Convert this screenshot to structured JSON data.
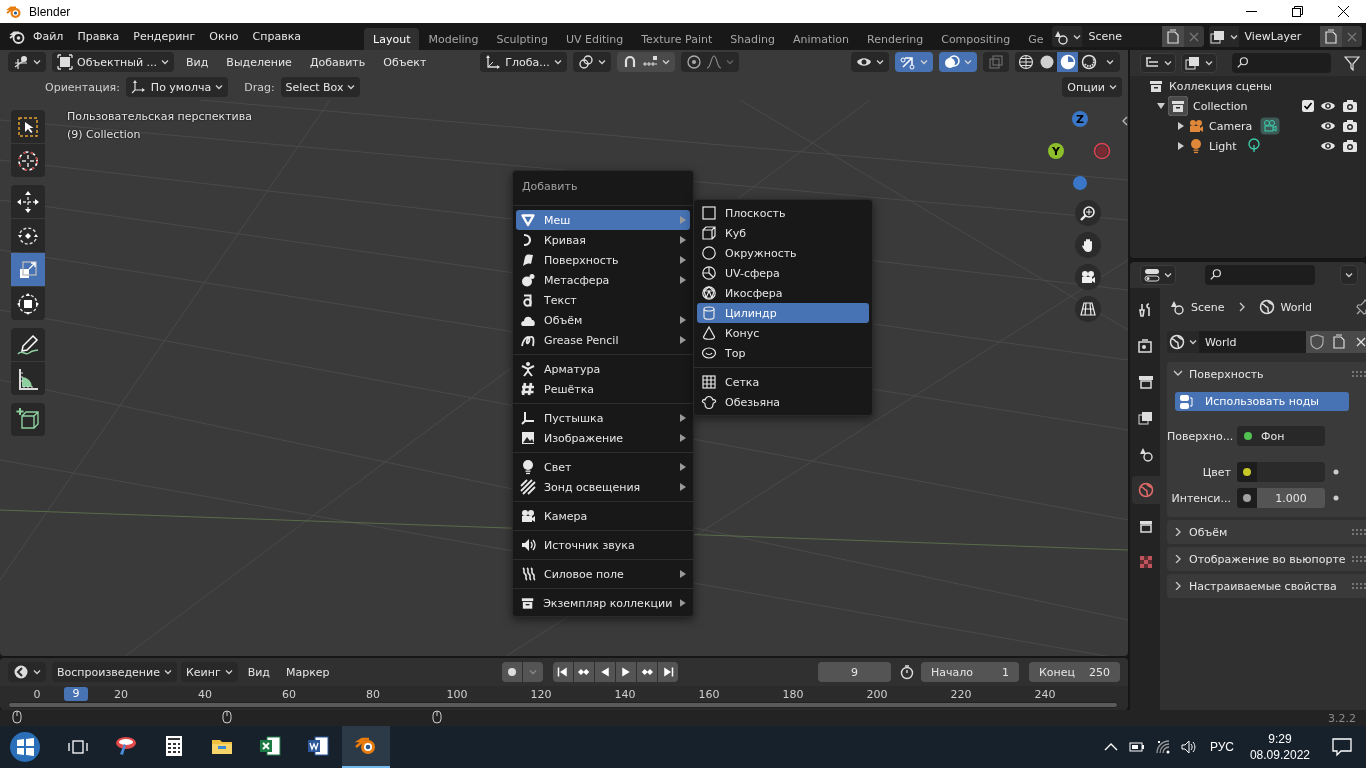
{
  "window": {
    "title": "Blender"
  },
  "menubar": [
    "Файл",
    "Правка",
    "Рендеринг",
    "Окно",
    "Справка"
  ],
  "workspaces": [
    {
      "label": "Layout",
      "selected": true
    },
    {
      "label": "Modeling",
      "selected": false
    },
    {
      "label": "Sculpting",
      "selected": false
    },
    {
      "label": "UV Editing",
      "selected": false
    },
    {
      "label": "Texture Paint",
      "selected": false
    },
    {
      "label": "Shading",
      "selected": false
    },
    {
      "label": "Animation",
      "selected": false
    },
    {
      "label": "Rendering",
      "selected": false
    },
    {
      "label": "Compositing",
      "selected": false
    },
    {
      "label": "Ge",
      "selected": false
    }
  ],
  "scene": "Scene",
  "view_layer": "ViewLayer",
  "viewport_header": {
    "mode": "Объектный ...",
    "menus": [
      "Вид",
      "Выделение",
      "Добавить",
      "Объект"
    ],
    "orientation": "Глоба...",
    "gizmos_on": true,
    "overlays_on": true,
    "shading": [
      {
        "selected": false
      },
      {
        "selected": false
      },
      {
        "selected": true
      },
      {
        "selected": false
      }
    ]
  },
  "tool_settings": {
    "orientation_label": "Ориентация:",
    "orientation": "По умолча",
    "drag_label": "Drag:",
    "drag": "Select Box",
    "options": "Опции"
  },
  "viewport": {
    "view_name": "Пользовательская перспектива",
    "collection": "(9) Collection",
    "gizmo_z": "Z",
    "gizmo_y": "Y"
  },
  "toolbar": [
    [
      {
        "selected": false
      },
      {
        "selected": false
      }
    ],
    [
      {
        "selected": false
      },
      {
        "selected": false
      },
      {
        "selected": true
      },
      {
        "selected": false
      }
    ],
    [
      {
        "selected": false
      },
      {
        "selected": false
      }
    ],
    [
      {
        "selected": false
      }
    ]
  ],
  "add_menu": {
    "title": "Добавить",
    "groups": [
      [
        {
          "label": "Меш",
          "submenu": true,
          "selected": true
        },
        {
          "label": "Кривая",
          "submenu": true,
          "selected": false
        },
        {
          "label": "Поверхность",
          "submenu": true,
          "selected": false
        },
        {
          "label": "Метасфера",
          "submenu": true,
          "selected": false
        },
        {
          "label": "Текст",
          "submenu": false,
          "selected": false
        },
        {
          "label": "Объём",
          "submenu": true,
          "selected": false
        },
        {
          "label": "Grease Pencil",
          "submenu": true,
          "selected": false
        }
      ],
      [
        {
          "label": "Арматура",
          "submenu": false,
          "selected": false
        },
        {
          "label": "Решётка",
          "submenu": false,
          "selected": false
        }
      ],
      [
        {
          "label": "Пустышка",
          "submenu": true,
          "selected": false
        },
        {
          "label": "Изображение",
          "submenu": true,
          "selected": false
        }
      ],
      [
        {
          "label": "Свет",
          "submenu": true,
          "selected": false
        },
        {
          "label": "Зонд освещения",
          "submenu": true,
          "selected": false
        }
      ],
      [
        {
          "label": "Камера",
          "submenu": false,
          "selected": false
        }
      ],
      [
        {
          "label": "Источник звука",
          "submenu": false,
          "selected": false
        }
      ],
      [
        {
          "label": "Силовое поле",
          "submenu": true,
          "selected": false
        }
      ],
      [
        {
          "label": "Экземпляр коллекции",
          "submenu": true,
          "selected": false
        }
      ]
    ]
  },
  "mesh_submenu": {
    "groups": [
      [
        {
          "label": "Плоскость",
          "selected": false
        },
        {
          "label": "Куб",
          "selected": false
        },
        {
          "label": "Окружность",
          "selected": false
        },
        {
          "label": "UV-сфера",
          "selected": false
        },
        {
          "label": "Икосфера",
          "selected": false
        },
        {
          "label": "Цилиндр",
          "selected": true
        },
        {
          "label": "Конус",
          "selected": false
        },
        {
          "label": "Тор",
          "selected": false
        }
      ],
      [
        {
          "label": "Сетка",
          "selected": false
        },
        {
          "label": "Обезьяна",
          "selected": false
        }
      ]
    ]
  },
  "outliner": {
    "tree": [
      {
        "label": "Коллекция сцены",
        "children": [
          {
            "label": "Collection",
            "expanded": true,
            "checked": true,
            "children": [
              {
                "label": "Camera",
                "expanded": false
              },
              {
                "label": "Light",
                "expanded": false
              }
            ]
          }
        ]
      }
    ]
  },
  "properties": {
    "tabs": [
      {
        "selected": false
      },
      {
        "selected": false
      },
      {
        "selected": false
      },
      {
        "selected": false
      },
      {
        "selected": false
      },
      {
        "selected": true
      },
      {
        "selected": false
      },
      {
        "selected": false
      }
    ],
    "breadcrumb": [
      "Scene",
      "World"
    ],
    "world": "World",
    "panels": [
      {
        "title": "Поверхность",
        "expanded": true,
        "button": "Использовать ноды",
        "fields": [
          {
            "kind": "shader",
            "label": "Поверхно...",
            "value": "Фон",
            "color": "#52c152",
            "animatable": false
          },
          {
            "kind": "color",
            "label": "Цвет",
            "color": "#c7c729",
            "animatable": true
          },
          {
            "kind": "number",
            "label": "Интенси...",
            "value": "1.000",
            "color": "#a1a1a1",
            "animatable": true
          }
        ]
      },
      {
        "title": "Объём",
        "expanded": false
      },
      {
        "title": "Отображение во вьюпорте",
        "expanded": false
      },
      {
        "title": "Настраиваемые свойства",
        "expanded": false
      }
    ]
  },
  "timeline": {
    "menus": [
      {
        "label": "Воспроизведение",
        "dropdown": true
      },
      {
        "label": "Кеинг",
        "dropdown": true
      },
      {
        "label": "Вид",
        "dropdown": false
      },
      {
        "label": "Маркер",
        "dropdown": false
      }
    ],
    "current_frame": "9",
    "start_label": "Начало",
    "start": "1",
    "end_label": "Конец",
    "end": "250",
    "ruler": [
      "0",
      "20",
      "40",
      "60",
      "80",
      "100",
      "120",
      "140",
      "160",
      "180",
      "200",
      "220",
      "240"
    ],
    "ruler_current": "9"
  },
  "status_bar": {
    "version": "3.2.2"
  },
  "taskbar": {
    "apps": [
      {
        "active": false
      },
      {
        "active": false
      },
      {
        "active": false
      },
      {
        "active": false
      },
      {
        "active": false
      },
      {
        "active": true
      }
    ],
    "language": "РУС",
    "time": "9:29",
    "date": "08.09.2022"
  }
}
